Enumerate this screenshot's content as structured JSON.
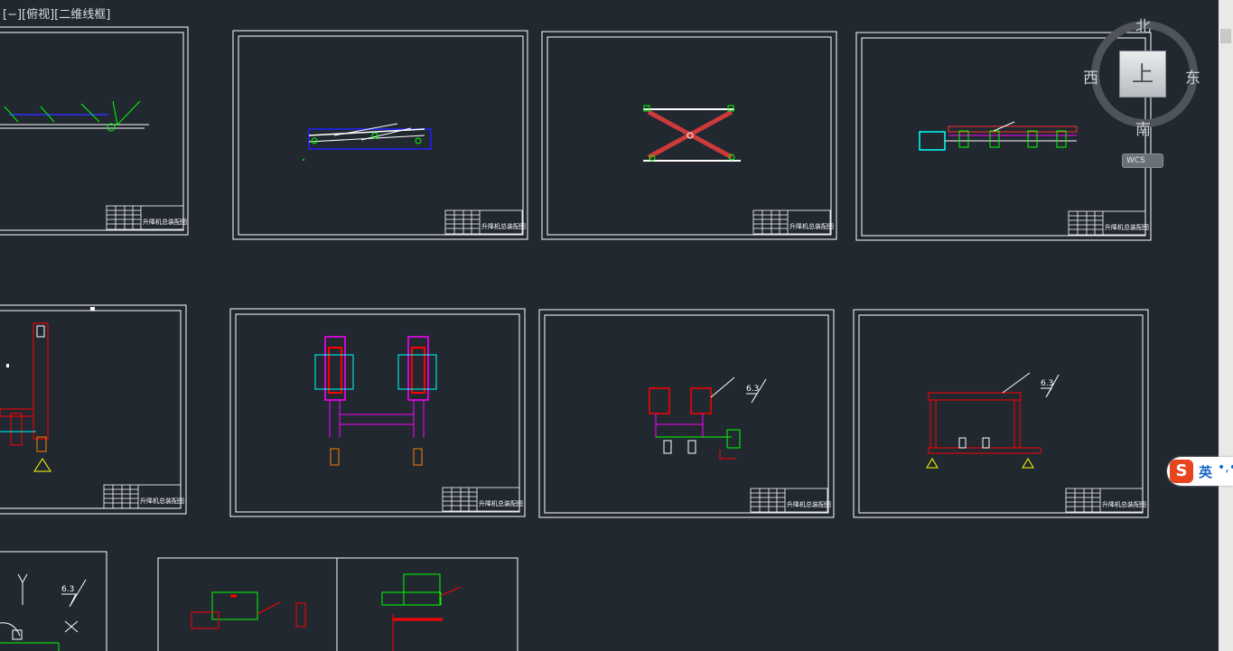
{
  "viewport": {
    "label": "[−][俯视][二维线框]"
  },
  "viewcube": {
    "north": "北",
    "south": "南",
    "east": "东",
    "west": "西",
    "face": "上",
    "wcs": "WCS"
  },
  "title_block_text": "升降机总装配图",
  "annotations": {
    "roughness": "6.3"
  },
  "ime": {
    "logo": "S",
    "lang": "英",
    "dots": "•,•"
  },
  "colors": {
    "background": "#212830",
    "frame": "#ffffff",
    "green": "#00ff00",
    "red": "#ff0000",
    "magenta": "#ff00ff",
    "cyan": "#00ffff",
    "blue": "#0000ff",
    "yellow": "#ffff00",
    "orange": "#ff8000"
  }
}
